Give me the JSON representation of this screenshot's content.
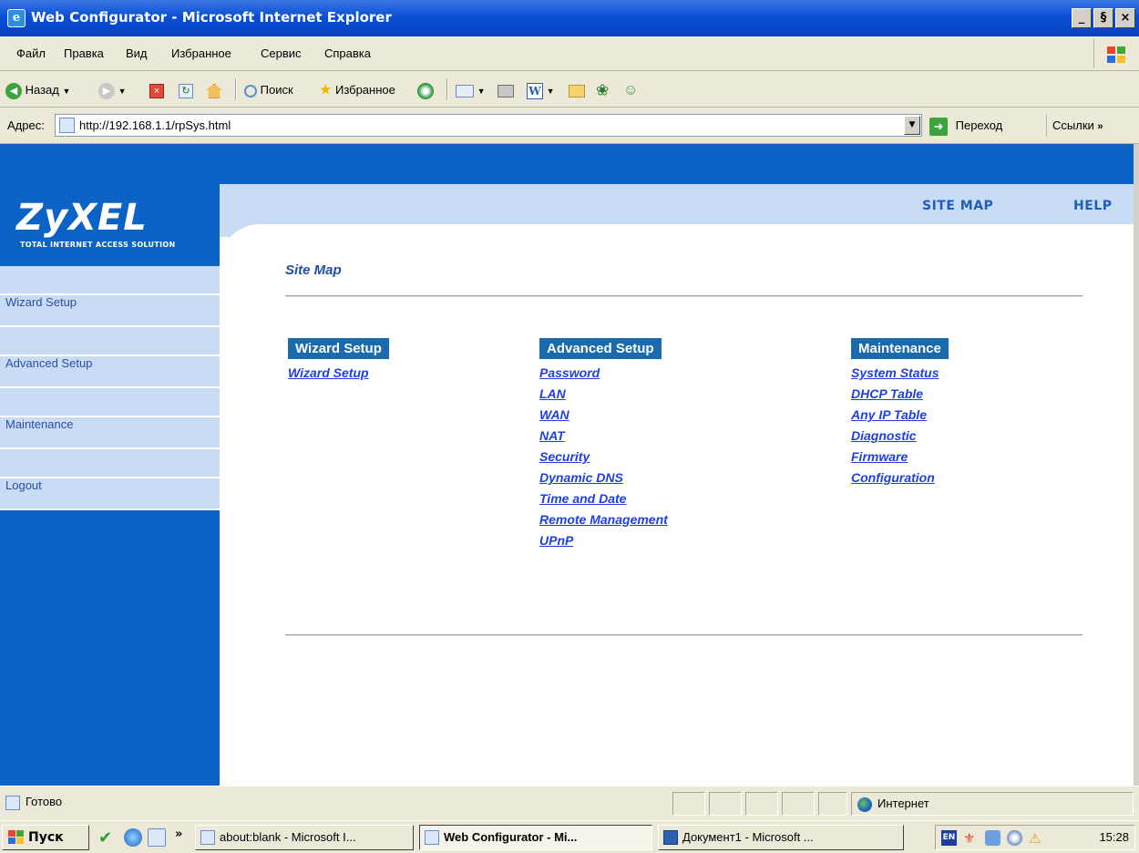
{
  "window": {
    "title": "Web Configurator - Microsoft Internet Explorer",
    "controls": {
      "minimize": "_",
      "maximize": "§",
      "close": "×"
    }
  },
  "menubar": {
    "items": [
      "Файл",
      "Правка",
      "Вид",
      "Избранное",
      "Сервис",
      "Справка"
    ]
  },
  "toolbar": {
    "back_label": "Назад",
    "search_label": "Поиск",
    "favorites_label": "Избранное"
  },
  "addressbar": {
    "label": "Адрес:",
    "url": "http://192.168.1.1/rpSys.html",
    "go_label": "Переход",
    "links_label": "Ссылки"
  },
  "brand": {
    "logo": "ZyXEL",
    "tagline": "TOTAL INTERNET ACCESS SOLUTION"
  },
  "header_links": {
    "site_map": "SITE MAP",
    "help": "HELP"
  },
  "sidebar": {
    "items": [
      "Wizard Setup",
      "Advanced Setup",
      "Maintenance",
      "Logout"
    ]
  },
  "main": {
    "title": "Site Map",
    "columns": [
      {
        "heading": "Wizard Setup",
        "links": [
          "Wizard Setup"
        ]
      },
      {
        "heading": "Advanced Setup",
        "links": [
          "Password",
          "LAN",
          "WAN",
          "NAT",
          "Security",
          "Dynamic DNS",
          "Time and Date",
          "Remote Management",
          "UPnP"
        ]
      },
      {
        "heading": "Maintenance",
        "links": [
          "System Status",
          "DHCP Table",
          "Any IP Table",
          "Diagnostic",
          "Firmware",
          "Configuration"
        ]
      }
    ]
  },
  "statusbar": {
    "text": "Готово",
    "zone": "Интернет"
  },
  "taskbar": {
    "start_label": "Пуск",
    "tasks": [
      {
        "label": "about:blank - Microsoft I...",
        "active": false
      },
      {
        "label": "Web Configurator - Mi...",
        "active": true
      },
      {
        "label": "Документ1 - Microsoft ...",
        "active": false
      }
    ],
    "language": "EN",
    "clock": "15:28"
  },
  "colors": {
    "brand_blue": "#0b63c6",
    "nav_light_blue": "#c9dcf5",
    "heading_bar": "#1a6ab0",
    "link_blue": "#1f3fe0"
  }
}
